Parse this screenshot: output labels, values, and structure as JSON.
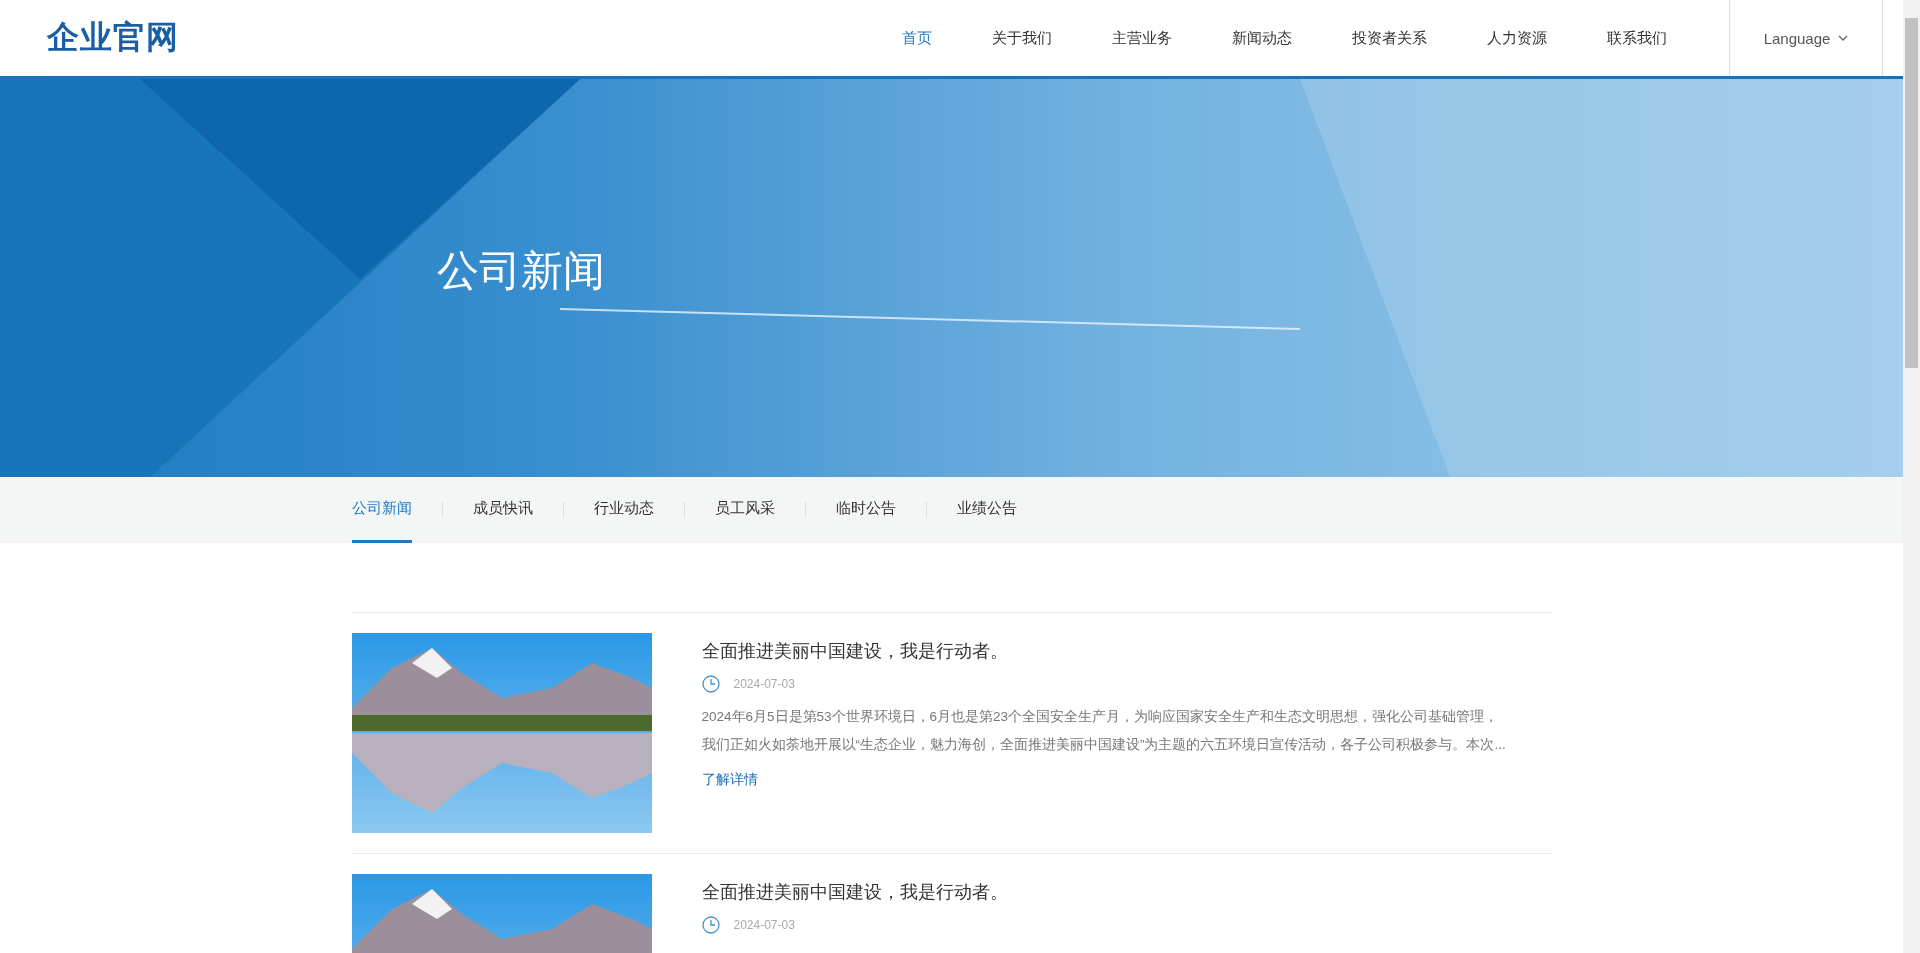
{
  "header": {
    "logo": "企业官网",
    "nav": [
      {
        "label": "首页",
        "selected": true
      },
      {
        "label": "关于我们",
        "selected": false
      },
      {
        "label": "主营业务",
        "selected": false
      },
      {
        "label": "新闻动态",
        "selected": false
      },
      {
        "label": "投资者关系",
        "selected": false
      },
      {
        "label": "人力资源",
        "selected": false
      },
      {
        "label": "联系我们",
        "selected": false
      }
    ],
    "language": "Language"
  },
  "banner": {
    "title": "公司新闻"
  },
  "subnav": [
    {
      "label": "公司新闻",
      "selected": true
    },
    {
      "label": "成员快讯",
      "selected": false
    },
    {
      "label": "行业动态",
      "selected": false
    },
    {
      "label": "员工风采",
      "selected": false
    },
    {
      "label": "临时公告",
      "selected": false
    },
    {
      "label": "业绩公告",
      "selected": false
    }
  ],
  "articles": [
    {
      "title": "全面推进美丽中国建设，我是行动者。",
      "date": "2024-07-03",
      "summary": "2024年6月5日是第53个世界环境日，6月也是第23个全国安全生产月，为响应国家安全生产和生态文明思想，强化公司基础管理，我们正如火如荼地开展以“生态企业，魅力海创，全面推进美丽中国建设”为主题的六五环境日宣传活动，各子公司积极参与。本次...",
      "link": "了解详情"
    },
    {
      "title": "全面推进美丽中国建设，我是行动者。",
      "date": "2024-07-03"
    }
  ]
}
